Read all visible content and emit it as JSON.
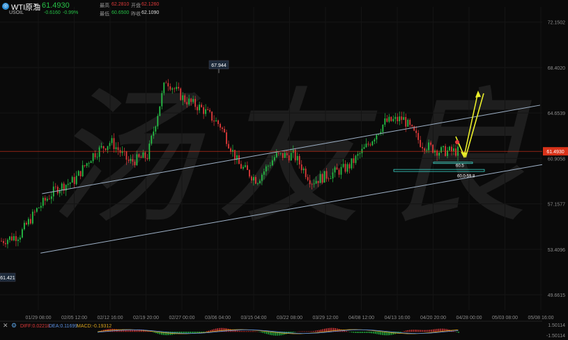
{
  "header": {
    "logo_icon": "oil-drop-icon",
    "instrument": "WTI原油",
    "price": "61.4930",
    "symbol": "USOIL",
    "change": "-0.6160",
    "change_pct": "-0.99%",
    "high_label": "最高",
    "high_value": "62.2810",
    "open_label": "开盘",
    "open_value": "62.1260",
    "low_label": "最低",
    "low_value": "60.6500",
    "prev_close_label": "昨收",
    "prev_close_value": "62.1090"
  },
  "watermark_text": "汤友良",
  "price_axis": {
    "ticks": [
      "72.1502",
      "68.4020",
      "64.6539",
      "60.9058",
      "57.1577",
      "53.4096",
      "49.6615"
    ],
    "current_tag": "61.4930"
  },
  "time_axis": {
    "ticks": [
      "01/29 08:00",
      "02/05 12:00",
      "02/12 16:00",
      "02/19 20:00",
      "02/27 00:00",
      "03/06 04:00",
      "03/15 04:00",
      "03/22 08:00",
      "03/29 12:00",
      "04/08 12:00",
      "04/13 16:00",
      "04/20 20:00",
      "04/28 00:00",
      "05/03 08:00",
      "05/08 16:00"
    ]
  },
  "annotations": {
    "high_marker": "67.944",
    "low_marker": "61.421",
    "support_zone_label_1": "60.5",
    "support_zone_label_2": "60.0-59.8"
  },
  "macd_panel": {
    "diff_label": "DIFF:0.02218",
    "dea_label": "DEA:0.11699",
    "macd_label": "MACD:-0.19312",
    "axis_top": "1.50114",
    "axis_bottom": "-1.50114"
  },
  "colors": {
    "up": "#26c046",
    "down": "#e03a3a",
    "channel": "#9fb2c8",
    "arrow": "#e8ec2a",
    "zone": "#3ad6c9",
    "current_price": "#d9331a"
  },
  "chart_data": {
    "type": "candlestick",
    "title": "",
    "xlabel": "",
    "ylabel": "",
    "ylim": [
      48.4,
      73.4
    ],
    "x": [
      "01/29 08:00",
      "02/05 12:00",
      "02/12 16:00",
      "02/19 20:00",
      "02/27 00:00",
      "03/06 04:00",
      "03/15 04:00",
      "03/22 08:00",
      "03/29 12:00",
      "04/08 12:00",
      "04/13 16:00",
      "04/20 20:00",
      "04/28 00:00"
    ],
    "close_path": [
      54.1,
      54.6,
      56.8,
      58.4,
      59.1,
      61.2,
      62.3,
      60.6,
      61.1,
      67.4,
      65.8,
      65.0,
      63.6,
      60.4,
      59.1,
      61.1,
      61.2,
      59.0,
      59.6,
      60.2,
      61.9,
      63.9,
      64.2,
      62.1,
      61.5,
      61.49
    ],
    "current_price": 61.493,
    "series": [
      {
        "name": "channel_upper",
        "line": [
          [
            60.3,
            58.0
          ],
          [
            775,
            65.3
          ]
        ]
      },
      {
        "name": "channel_lower",
        "line": [
          [
            58.2,
            53.1
          ],
          [
            778,
            60.4
          ]
        ]
      }
    ]
  }
}
